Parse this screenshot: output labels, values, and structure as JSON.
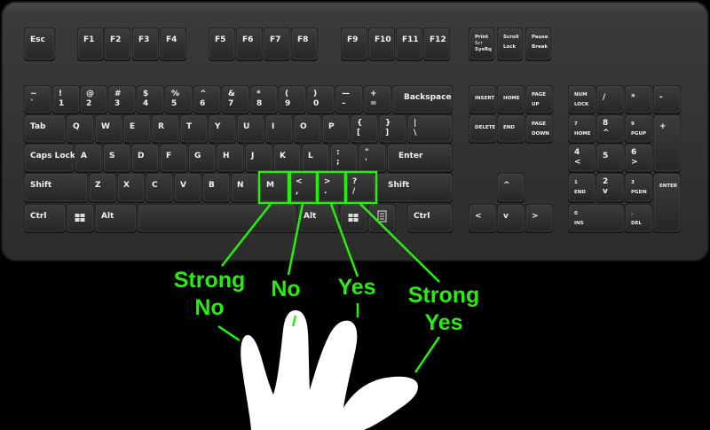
{
  "keyboard": {
    "keys": [
      {
        "id": "esc",
        "top": "Esc"
      },
      {
        "id": "f1",
        "top": "F1"
      },
      {
        "id": "f2",
        "top": "F2"
      },
      {
        "id": "f3",
        "top": "F3"
      },
      {
        "id": "f4",
        "top": "F4"
      },
      {
        "id": "f5",
        "top": "F5"
      },
      {
        "id": "f6",
        "top": "F6"
      },
      {
        "id": "f7",
        "top": "F7"
      },
      {
        "id": "f8",
        "top": "F8"
      },
      {
        "id": "f9",
        "top": "F9"
      },
      {
        "id": "f10",
        "top": "F10"
      },
      {
        "id": "f11",
        "top": "F11"
      },
      {
        "id": "f12",
        "top": "F12"
      },
      {
        "id": "prtsc",
        "top": "Print",
        "mid": "Scr",
        "bottom": "SysRq"
      },
      {
        "id": "scrlk",
        "top": "Scroll",
        "bottom": "Lock"
      },
      {
        "id": "pause",
        "top": "Pause",
        "bottom": "Break"
      },
      {
        "id": "backtick",
        "top": "~",
        "bottom": "`"
      },
      {
        "id": "d1",
        "top": "!",
        "bottom": "1"
      },
      {
        "id": "d2",
        "top": "@",
        "bottom": "2"
      },
      {
        "id": "d3",
        "top": "#",
        "bottom": "3"
      },
      {
        "id": "d4",
        "top": "$",
        "bottom": "4"
      },
      {
        "id": "d5",
        "top": "%",
        "bottom": "5"
      },
      {
        "id": "d6",
        "top": "^",
        "bottom": "6"
      },
      {
        "id": "d7",
        "top": "&",
        "bottom": "7"
      },
      {
        "id": "d8",
        "top": "*",
        "bottom": "8"
      },
      {
        "id": "d9",
        "top": "(",
        "bottom": "9"
      },
      {
        "id": "d0",
        "top": ")",
        "bottom": "0"
      },
      {
        "id": "minus",
        "top": "—",
        "bottom": "–"
      },
      {
        "id": "equal",
        "top": "+",
        "bottom": "="
      },
      {
        "id": "backspace",
        "top": "Backspace"
      },
      {
        "id": "insert",
        "top": "INSERT"
      },
      {
        "id": "home",
        "top": "HOME"
      },
      {
        "id": "pgup",
        "top": "PAGE",
        "bottom": "UP"
      },
      {
        "id": "numlock",
        "top": "NUM",
        "bottom": "LOCK"
      },
      {
        "id": "npdiv",
        "top": "/"
      },
      {
        "id": "npmul",
        "top": "*"
      },
      {
        "id": "npsub",
        "top": "-"
      },
      {
        "id": "tab",
        "top": "Tab"
      },
      {
        "id": "q",
        "top": "Q"
      },
      {
        "id": "w",
        "top": "W"
      },
      {
        "id": "e",
        "top": "E"
      },
      {
        "id": "r",
        "top": "R"
      },
      {
        "id": "t",
        "top": "T"
      },
      {
        "id": "y",
        "top": "Y"
      },
      {
        "id": "u",
        "top": "U"
      },
      {
        "id": "i",
        "top": "I"
      },
      {
        "id": "o",
        "top": "O"
      },
      {
        "id": "p",
        "top": "P"
      },
      {
        "id": "lbracket",
        "top": "{",
        "bottom": "["
      },
      {
        "id": "rbracket",
        "top": "}",
        "bottom": "]"
      },
      {
        "id": "backslash",
        "top": "|",
        "bottom": "\\"
      },
      {
        "id": "delete",
        "top": "DELETE"
      },
      {
        "id": "end",
        "top": "END"
      },
      {
        "id": "pgdn",
        "top": "PAGE",
        "bottom": "DOWN"
      },
      {
        "id": "np7",
        "top": "7",
        "bottom": "HOME"
      },
      {
        "id": "np8",
        "top": "8",
        "bottom": "^"
      },
      {
        "id": "np9",
        "top": "9",
        "bottom": "PGUP"
      },
      {
        "id": "npadd",
        "top": "+"
      },
      {
        "id": "caps",
        "top": "Caps Lock"
      },
      {
        "id": "a",
        "top": "A"
      },
      {
        "id": "s",
        "top": "S"
      },
      {
        "id": "d",
        "top": "D"
      },
      {
        "id": "f",
        "top": "F"
      },
      {
        "id": "g",
        "top": "G"
      },
      {
        "id": "h",
        "top": "H"
      },
      {
        "id": "j",
        "top": "J"
      },
      {
        "id": "k",
        "top": "K"
      },
      {
        "id": "l",
        "top": "L"
      },
      {
        "id": "semicolon",
        "top": ":",
        "bottom": ";"
      },
      {
        "id": "quote",
        "top": "\"",
        "bottom": "'"
      },
      {
        "id": "enter",
        "top": "Enter"
      },
      {
        "id": "np4",
        "top": "4",
        "bottom": "<"
      },
      {
        "id": "np5",
        "top": "5"
      },
      {
        "id": "np6",
        "top": "6",
        "bottom": ">"
      },
      {
        "id": "lshift",
        "top": "Shift"
      },
      {
        "id": "z",
        "top": "Z"
      },
      {
        "id": "x",
        "top": "X"
      },
      {
        "id": "c",
        "top": "C"
      },
      {
        "id": "v",
        "top": "V"
      },
      {
        "id": "b",
        "top": "B"
      },
      {
        "id": "n",
        "top": "N"
      },
      {
        "id": "m",
        "top": "M"
      },
      {
        "id": "comma",
        "top": "<",
        "bottom": ","
      },
      {
        "id": "period",
        "top": ">",
        "bottom": "."
      },
      {
        "id": "slash",
        "top": "?",
        "bottom": "/"
      },
      {
        "id": "rshift",
        "top": "Shift"
      },
      {
        "id": "up",
        "top": "^"
      },
      {
        "id": "np1",
        "top": "1",
        "bottom": "END"
      },
      {
        "id": "np2",
        "top": "2",
        "bottom": "v"
      },
      {
        "id": "np3",
        "top": "3",
        "bottom": "PGDN"
      },
      {
        "id": "npenter",
        "top": "ENTER"
      },
      {
        "id": "lctrl",
        "top": "Ctrl"
      },
      {
        "id": "lwin",
        "icon": "windows-logo"
      },
      {
        "id": "lalt",
        "top": "Alt"
      },
      {
        "id": "space",
        "top": ""
      },
      {
        "id": "ralt",
        "top": "Alt"
      },
      {
        "id": "rwin",
        "icon": "windows-logo"
      },
      {
        "id": "menu",
        "icon": "menu-icon"
      },
      {
        "id": "rctrl",
        "top": "Ctrl"
      },
      {
        "id": "left",
        "top": "<"
      },
      {
        "id": "down",
        "top": "v"
      },
      {
        "id": "right",
        "top": ">"
      },
      {
        "id": "np0",
        "top": "0",
        "bottom": "INS"
      },
      {
        "id": "npdel",
        "top": ".",
        "bottom": "DEL"
      }
    ]
  },
  "labels": [
    {
      "key": "m",
      "lines": [
        "Strong",
        "No"
      ]
    },
    {
      "key": "comma",
      "lines": [
        "No"
      ]
    },
    {
      "key": "period",
      "lines": [
        "Yes"
      ]
    },
    {
      "key": "slash",
      "lines": [
        "Strong",
        "Yes"
      ]
    }
  ],
  "colors": {
    "highlight": "#27ee0c",
    "key_face": "#2e2e2e",
    "key_edge": "#111111",
    "case": "#383838",
    "hand": "#ffffff"
  }
}
